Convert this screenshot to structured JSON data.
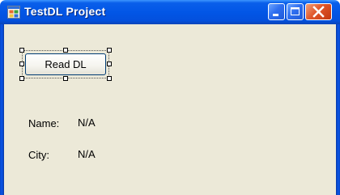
{
  "window": {
    "title": "TestDL Project",
    "icon": "form-app-icon"
  },
  "form": {
    "read_button_label": "Read DL",
    "name_label": "Name:",
    "name_value": "N/A",
    "city_label": "City:",
    "city_value": "N/A"
  },
  "colors": {
    "titlebar": "#0256e6",
    "client_bg": "#ece9d8",
    "close_button": "#e0562a"
  }
}
